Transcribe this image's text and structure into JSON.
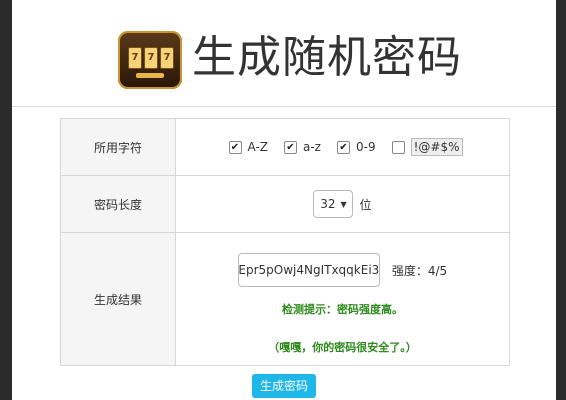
{
  "header": {
    "title": "生成随机密码"
  },
  "form": {
    "charset_label": "所用字符",
    "options": [
      {
        "label": "A-Z",
        "checked": true
      },
      {
        "label": "a-z",
        "checked": true
      },
      {
        "label": "0-9",
        "checked": true
      },
      {
        "label": "!@#$%",
        "checked": false
      }
    ],
    "length_label": "密码长度",
    "length_value": "32",
    "length_unit": "位",
    "result_label": "生成结果",
    "password": "Epr5pOwj4NgITxqqkEi3",
    "strength": "强度：4/5",
    "hint": "检测提示：密码强度高。",
    "hint2": "（嘎嘎，你的密码很安全了。）"
  },
  "generate_button": "生成密码",
  "icons": {
    "logo": "slot-machine-icon",
    "check": "checkmark-icon",
    "dropdown": "chevron-down-icon"
  }
}
